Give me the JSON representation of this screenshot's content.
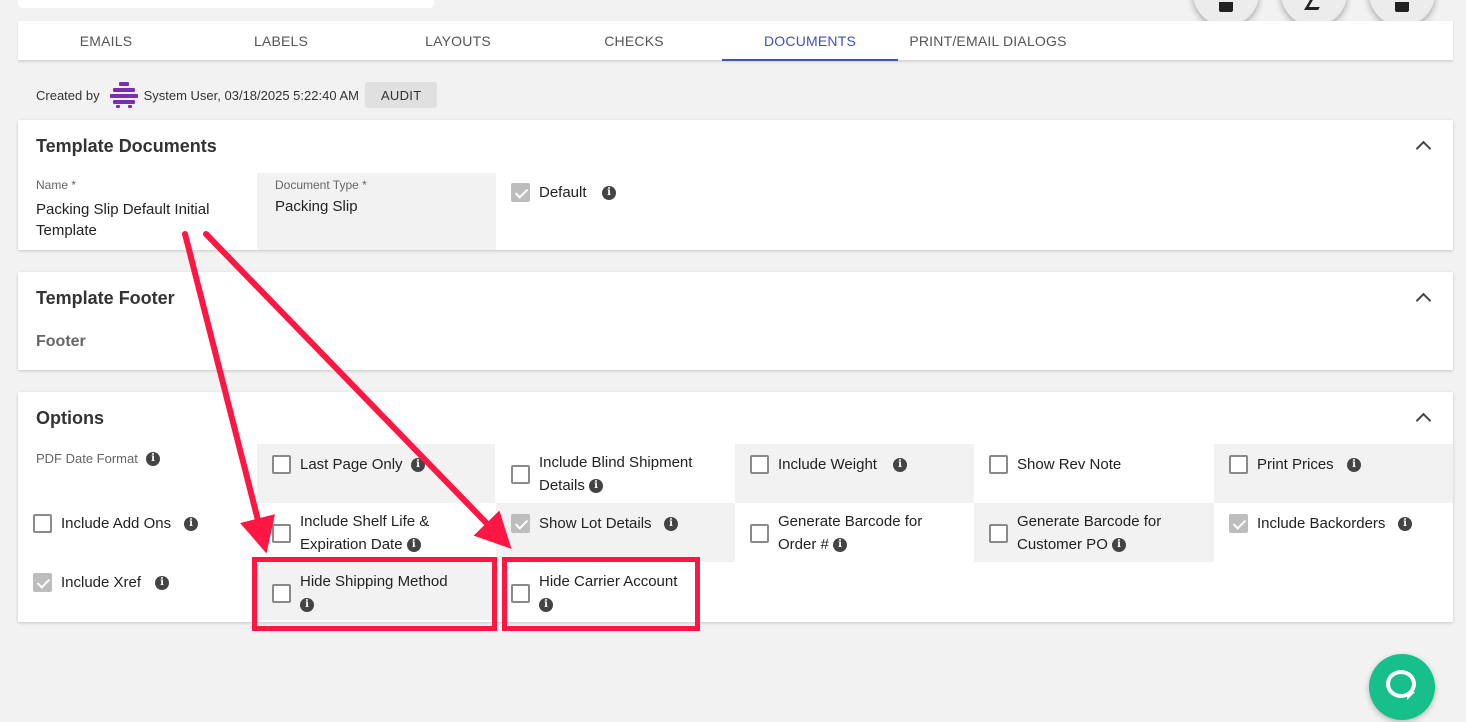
{
  "tabs": [
    "EMAILS",
    "LABELS",
    "LAYOUTS",
    "CHECKS",
    "DOCUMENTS",
    "PRINT/EMAIL DIALOGS"
  ],
  "active_tab": "DOCUMENTS",
  "created": {
    "prefix": "Created by",
    "text": "System User, 03/18/2025 5:22:40 AM",
    "audit_label": "AUDIT"
  },
  "template_documents": {
    "title": "Template Documents",
    "name_label": "Name *",
    "name_value": "Packing Slip Default Initial Template",
    "doctype_label": "Document Type *",
    "doctype_value": "Packing Slip",
    "default_label": "Default",
    "default_checked": true
  },
  "template_footer": {
    "title": "Template Footer",
    "footer_label": "Footer"
  },
  "options": {
    "title": "Options",
    "pdf_date_format_label": "PDF Date Format",
    "checkboxes": [
      {
        "label": "Last Page Only",
        "checked": false
      },
      {
        "label": "Include Blind Shipment Details",
        "checked": false
      },
      {
        "label": "Include Weight",
        "checked": false
      },
      {
        "label": "Show Rev Note",
        "checked": false
      },
      {
        "label": "Print Prices",
        "checked": false
      },
      {
        "label": "Include Add Ons",
        "checked": false
      },
      {
        "label": "Include Shelf Life & Expiration Date",
        "checked": false
      },
      {
        "label": "Show Lot Details",
        "checked": true
      },
      {
        "label": "Generate Barcode for Order #",
        "checked": false
      },
      {
        "label": "Generate Barcode for Customer PO",
        "checked": false
      },
      {
        "label": "Include Backorders",
        "checked": true
      },
      {
        "label": "Include Xref",
        "checked": true
      },
      {
        "label": "Hide Shipping Method",
        "checked": false
      },
      {
        "label": "Hide Carrier Account",
        "checked": false
      }
    ]
  },
  "colors": {
    "accent": "#3f51b5",
    "annotation": "#ff1744",
    "chat": "#17c08a"
  },
  "icons": [
    "info-icon",
    "chevron-up-icon",
    "copy-icon",
    "edit-icon",
    "save-icon",
    "chat-icon"
  ]
}
